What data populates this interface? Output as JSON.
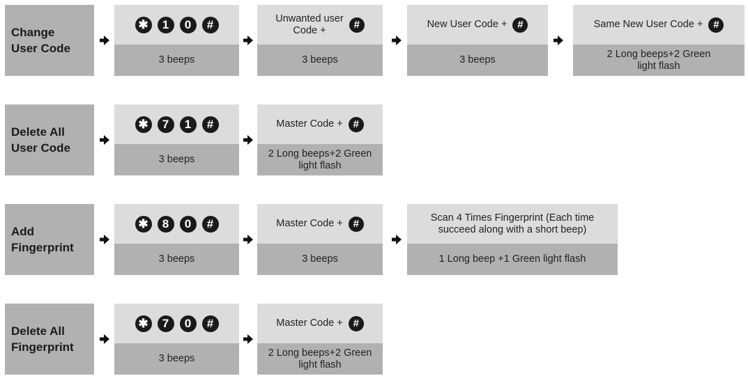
{
  "icons": {
    "star_key": "star-key-icon",
    "hash_key": "hash-key-icon",
    "arrow": "right-arrow-icon"
  },
  "colors": {
    "label_box": "#b1b1b1",
    "step_top": "#dcdcdc",
    "step_bottom": "#b1b1b1",
    "key_fill": "#1a1a1a"
  },
  "flows": [
    {
      "label": "Change\nUser Code",
      "steps": [
        {
          "keys": [
            "✱",
            "1",
            "0",
            "#"
          ],
          "result": "3 beeps"
        },
        {
          "text": "Unwanted user\nCode +",
          "key": "#",
          "result": "3 beeps"
        },
        {
          "text": "New User Code +",
          "key": "#",
          "result": "3 beeps"
        },
        {
          "text": "Same New User Code +",
          "key": "#",
          "result": "2 Long beeps+2 Green\nlight flash"
        }
      ]
    },
    {
      "label": "Delete All\nUser Code",
      "steps": [
        {
          "keys": [
            "✱",
            "7",
            "1",
            "#"
          ],
          "result": "3 beeps"
        },
        {
          "text": "Master Code +",
          "key": "#",
          "result": "2 Long beeps+2 Green\nlight flash"
        }
      ]
    },
    {
      "label": "Add\nFingerprint",
      "steps": [
        {
          "keys": [
            "✱",
            "8",
            "0",
            "#"
          ],
          "result": "3 beeps"
        },
        {
          "text": "Master Code +",
          "key": "#",
          "result": "3 beeps"
        },
        {
          "text": "Scan 4 Times Fingerprint (Each time\nsucceed along with a short beep)",
          "result": "1 Long beep +1 Green light flash"
        }
      ]
    },
    {
      "label": "Delete All\nFingerprint",
      "steps": [
        {
          "keys": [
            "✱",
            "7",
            "0",
            "#"
          ],
          "result": "3 beeps"
        },
        {
          "text": "Master Code +",
          "key": "#",
          "result": "2 Long beeps+2 Green\nlight flash"
        }
      ]
    }
  ]
}
